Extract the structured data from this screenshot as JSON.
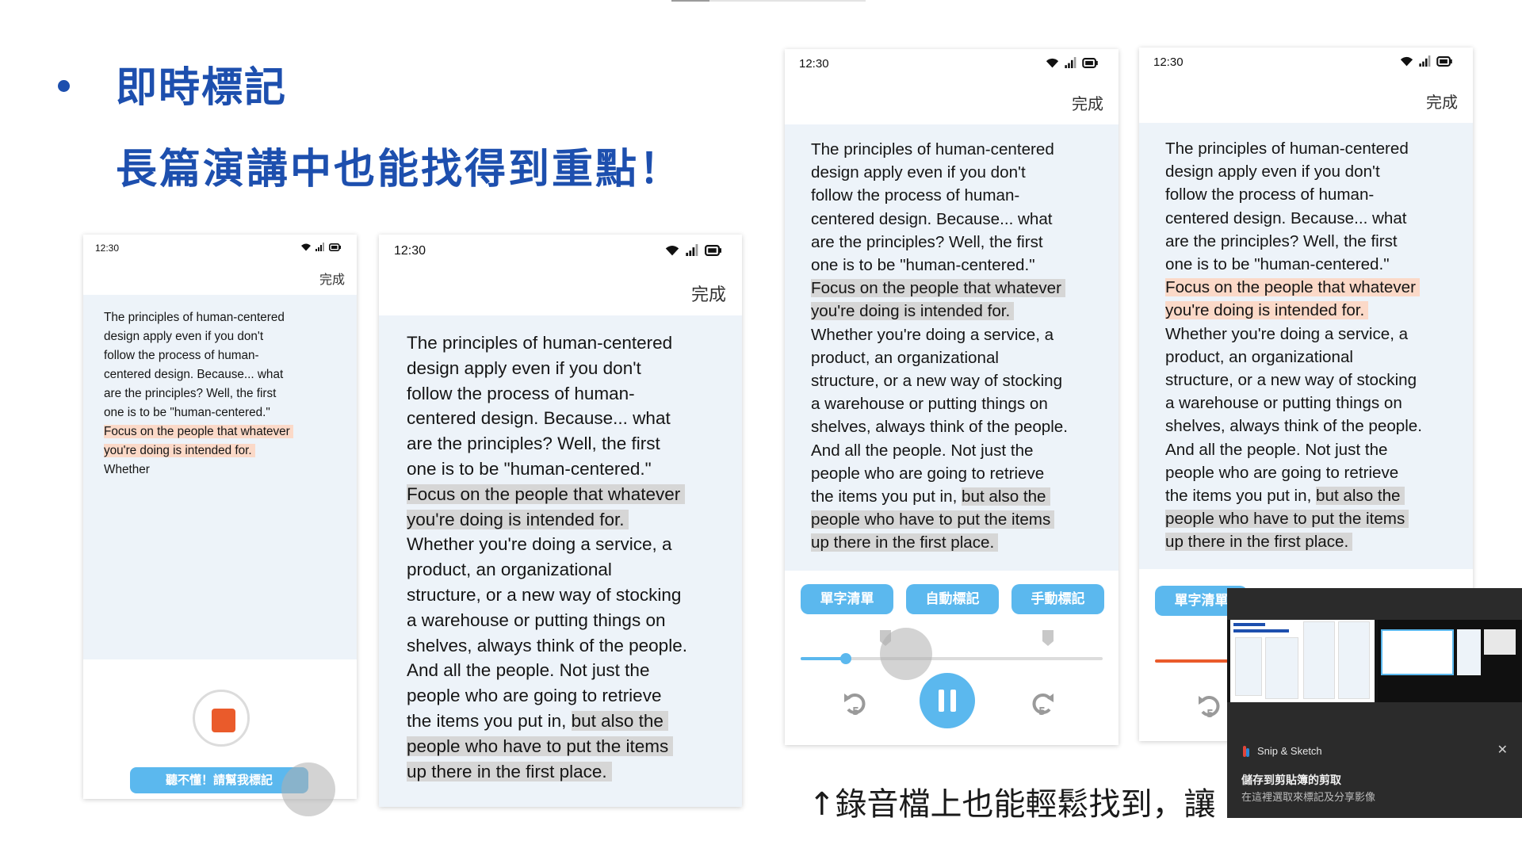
{
  "heading": {
    "title": "即時標記",
    "subtitle": "長篇演講中也能找得到重點！"
  },
  "phones": {
    "status_time": "12:30",
    "done_label": "完成"
  },
  "transcript": {
    "before": [
      "The principles of human-centered",
      "design apply even if you don't",
      "follow the process of human-",
      "centered design. Because... what",
      "are the principles? Well, the first",
      "one is to be \"human-centered.\""
    ],
    "highlight1": [
      "Focus on the people that whatever",
      "you're doing is intended for."
    ],
    "middle": [
      "Whether you're doing a service, a",
      "product, an organizational",
      "structure, or a new way of stocking",
      "a warehouse or putting things on",
      "shelves, always think of the people.",
      "And all the people. Not just the",
      "people who are going to retrieve"
    ],
    "split_plain": "the items you put in, ",
    "split_highlight": "but also the",
    "highlight2_rest": [
      "people who have to put the items",
      "up there in the first place."
    ],
    "partial_trailing": "Whether"
  },
  "recorder": {
    "mark_button": "聽不懂！請幫我標記"
  },
  "player": {
    "chips": [
      "單字清單",
      "自動標記",
      "手動標記"
    ],
    "progress": 0.15,
    "partial_chip": "單字清單"
  },
  "caption": "↑錄音檔上也能輕鬆找到，讓",
  "snip": {
    "app_name": "Snip & Sketch",
    "title": "儲存到剪貼簿的剪取",
    "subtitle": "在這裡選取來標記及分享影像"
  },
  "colors": {
    "heading": "#1d4fae",
    "chip": "#5bb8ee",
    "highlight_grey": "#d6d6d6",
    "highlight_peach": "#fbd9c8",
    "record_stop": "#ea5b2b",
    "transcript_bg": "#edf3f9"
  }
}
